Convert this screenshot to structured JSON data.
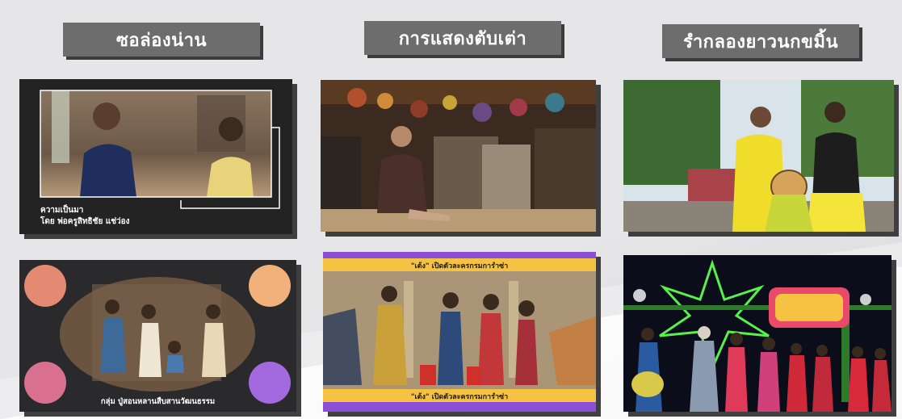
{
  "headers": {
    "col1": "ซอล่องน่าน",
    "col2": "การแสดงตับเต่า",
    "col3": "รำกลองยาวนกขมิ้น"
  },
  "cards": {
    "interview": {
      "caption_line1": "ความเป็นมา",
      "caption_line2": "โดย พ่อครูสิทธิชัย แช่ว่อง"
    },
    "group": {
      "caption": "กลุ่ม ปู่สอนหลานสืบสานวัฒนธรรม"
    },
    "dance": {
      "banner_top": "\"เต้ง\" เปิดตัวละครกรมการำซ่า",
      "banner_bottom": "\"เต้ง\" เปิดตัวละครกรมการำซ่า"
    }
  },
  "colors": {
    "header_bg": "#6d6d6d",
    "card_dark": "#222222",
    "banner_yellow": "#f5c242",
    "banner_purple": "#8a4fd6",
    "circle_salmon": "#e58a72",
    "circle_peach": "#f2b07a",
    "circle_pink": "#d9708f",
    "circle_violet": "#a36ae0"
  }
}
